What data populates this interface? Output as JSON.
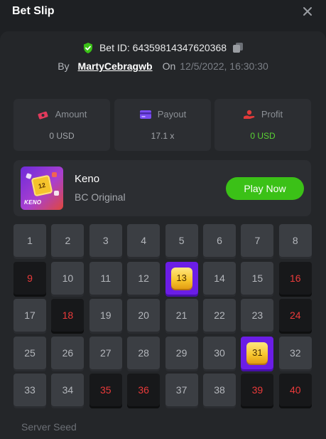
{
  "dialog": {
    "title": "Bet Slip"
  },
  "bet": {
    "id_label": "Bet ID: 64359814347620368",
    "by_label": "By",
    "username": "MartyCebragwb",
    "on_label": "On",
    "date": "12/5/2022, 16:30:30"
  },
  "stats": [
    {
      "label": "Amount",
      "value": "0 USD",
      "icon": "money-icon",
      "color": "#e23a5c"
    },
    {
      "label": "Payout",
      "value": "17.1 x",
      "icon": "card-icon",
      "color": "#7a4cf0"
    },
    {
      "label": "Profit",
      "value": "0 USD",
      "icon": "hand-coin-icon",
      "color": "#e23a3a"
    }
  ],
  "game": {
    "thumb_text": "KENO",
    "thumb_number": "12",
    "name": "Keno",
    "provider": "BC Original",
    "play_label": "Play Now"
  },
  "board": {
    "numbers": [
      "1",
      "2",
      "3",
      "4",
      "5",
      "6",
      "7",
      "8",
      "9",
      "10",
      "11",
      "12",
      "13",
      "14",
      "15",
      "16",
      "17",
      "18",
      "19",
      "20",
      "21",
      "22",
      "23",
      "24",
      "25",
      "26",
      "27",
      "28",
      "29",
      "30",
      "31",
      "32",
      "33",
      "34",
      "35",
      "36",
      "37",
      "38",
      "39",
      "40"
    ],
    "picked": [
      "9",
      "16",
      "18",
      "24",
      "35",
      "36",
      "39",
      "40"
    ],
    "hits": [
      "13",
      "31"
    ]
  },
  "footer": {
    "server_seed_label": "Server Seed"
  },
  "colors": {
    "accent_green": "#3bc117",
    "profit_green": "#5ad334",
    "picked_red": "#ea3a3a",
    "hit_purple": "#6b1de6",
    "gem_yellow": "#f7c52c"
  }
}
